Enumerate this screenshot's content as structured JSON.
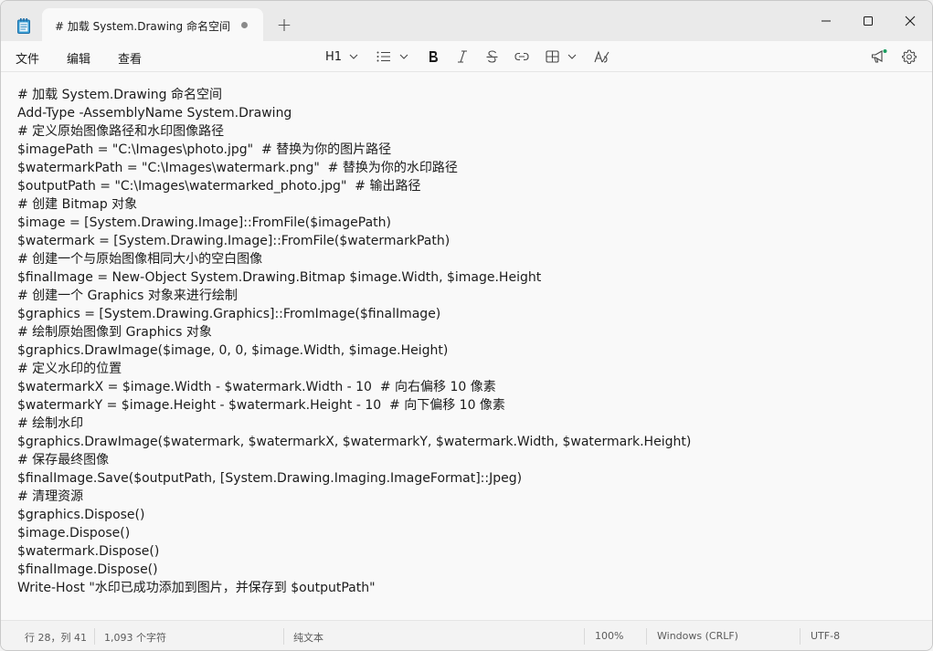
{
  "tab": {
    "title": "# 加载 System.Drawing 命名空间",
    "new_tab": "+"
  },
  "icons": {
    "app": "notepad-icon",
    "close_tab": "unsaved-dot-icon",
    "minimize": "minimize-icon",
    "maximize": "maximize-icon",
    "close": "close-icon"
  },
  "menu": {
    "file": "文件",
    "edit": "编辑",
    "view": "查看"
  },
  "format": {
    "heading": "H1"
  },
  "lines": [
    "# 加载 System.Drawing 命名空间",
    "Add-Type -AssemblyName System.Drawing",
    "# 定义原始图像路径和水印图像路径",
    "$imagePath = \"C:\\Images\\photo.jpg\"  # 替换为你的图片路径",
    "$watermarkPath = \"C:\\Images\\watermark.png\"  # 替换为你的水印路径",
    "$outputPath = \"C:\\Images\\watermarked_photo.jpg\"  # 输出路径",
    "# 创建 Bitmap 对象",
    "$image = [System.Drawing.Image]::FromFile($imagePath)",
    "$watermark = [System.Drawing.Image]::FromFile($watermarkPath)",
    "# 创建一个与原始图像相同大小的空白图像",
    "$finalImage = New-Object System.Drawing.Bitmap $image.Width, $image.Height",
    "# 创建一个 Graphics 对象来进行绘制",
    "$graphics = [System.Drawing.Graphics]::FromImage($finalImage)",
    "# 绘制原始图像到 Graphics 对象",
    "$graphics.DrawImage($image, 0, 0, $image.Width, $image.Height)",
    "# 定义水印的位置",
    "$watermarkX = $image.Width - $watermark.Width - 10  # 向右偏移 10 像素",
    "$watermarkY = $image.Height - $watermark.Height - 10  # 向下偏移 10 像素",
    "# 绘制水印",
    "$graphics.DrawImage($watermark, $watermarkX, $watermarkY, $watermark.Width, $watermark.Height)",
    "# 保存最终图像",
    "$finalImage.Save($outputPath, [System.Drawing.Imaging.ImageFormat]::Jpeg)",
    "# 清理资源",
    "$graphics.Dispose()",
    "$image.Dispose()",
    "$watermark.Dispose()",
    "$finalImage.Dispose()",
    "Write-Host \"水印已成功添加到图片，并保存到 $outputPath\""
  ],
  "status": {
    "position": "行 28，列 41",
    "char_count": "1,093 个字符",
    "mode": "纯文本",
    "zoom": "100%",
    "line_ending": "Windows (CRLF)",
    "encoding": "UTF-8"
  },
  "colors": {
    "accent": "#0f9d58",
    "notification_dot": "#1a9e60"
  }
}
